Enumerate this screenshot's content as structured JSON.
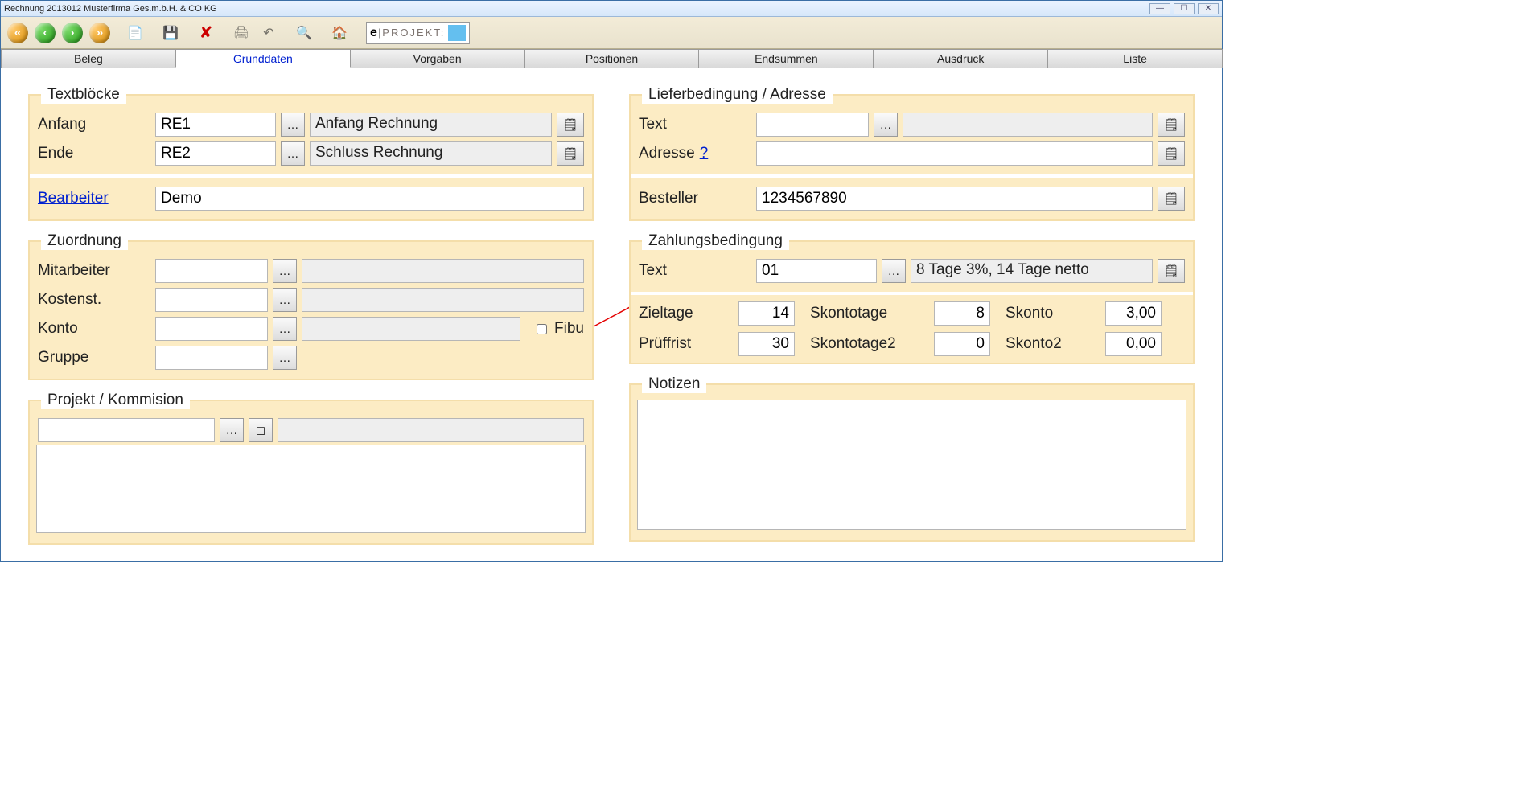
{
  "window": {
    "title": "Rechnung  2013012  Musterfirma Ges.m.b.H. & CO KG"
  },
  "toolbar": {
    "eprojekt_prefix": "e",
    "eprojekt_text": "PROJEKT:"
  },
  "tabs": {
    "beleg": "Beleg",
    "grunddaten": "Grunddaten",
    "vorgaben": "Vorgaben",
    "positionen": "Positionen",
    "endsummen": "Endsummen",
    "ausdruck": "Ausdruck",
    "liste": "Liste"
  },
  "textblocks": {
    "legend": "Textblöcke",
    "anfang_label": "Anfang",
    "anfang_code": "RE1",
    "anfang_desc": "Anfang Rechnung",
    "ende_label": "Ende",
    "ende_code": "RE2",
    "ende_desc": "Schluss Rechnung",
    "bearbeiter_label": "Bearbeiter",
    "bearbeiter_value": "Demo"
  },
  "zuordnung": {
    "legend": "Zuordnung",
    "mitarbeiter_label": "Mitarbeiter",
    "mitarbeiter_code": "",
    "mitarbeiter_desc": "",
    "kostenst_label": "Kostenst.",
    "kostenst_code": "",
    "kostenst_desc": "",
    "konto_label": "Konto",
    "konto_code": "",
    "konto_desc": "",
    "fibu_label": "Fibu",
    "gruppe_label": "Gruppe",
    "gruppe_code": ""
  },
  "projekt": {
    "legend": "Projekt / Kommision",
    "code": "",
    "desc": "",
    "notes": ""
  },
  "liefer": {
    "legend": "Lieferbedingung / Adresse",
    "text_label": "Text",
    "text_code": "",
    "text_desc": "",
    "adresse_label": "Adresse",
    "adresse_q": "?",
    "adresse_value": "",
    "besteller_label": "Besteller",
    "besteller_value": "1234567890"
  },
  "zahlung": {
    "legend": "Zahlungsbedingung",
    "text_label": "Text",
    "text_code": "01",
    "text_desc": "8 Tage 3%, 14 Tage netto",
    "zieltage_label": "Zieltage",
    "zieltage_value": "14",
    "skontotage_label": "Skontotage",
    "skontotage_value": "8",
    "skonto_label": "Skonto",
    "skonto_value": "3,00",
    "prueffrist_label": "Prüffrist",
    "prueffrist_value": "30",
    "skontotage2_label": "Skontotage2",
    "skontotage2_value": "0",
    "skonto2_label": "Skonto2",
    "skonto2_value": "0,00"
  },
  "notizen": {
    "legend": "Notizen",
    "value": ""
  }
}
